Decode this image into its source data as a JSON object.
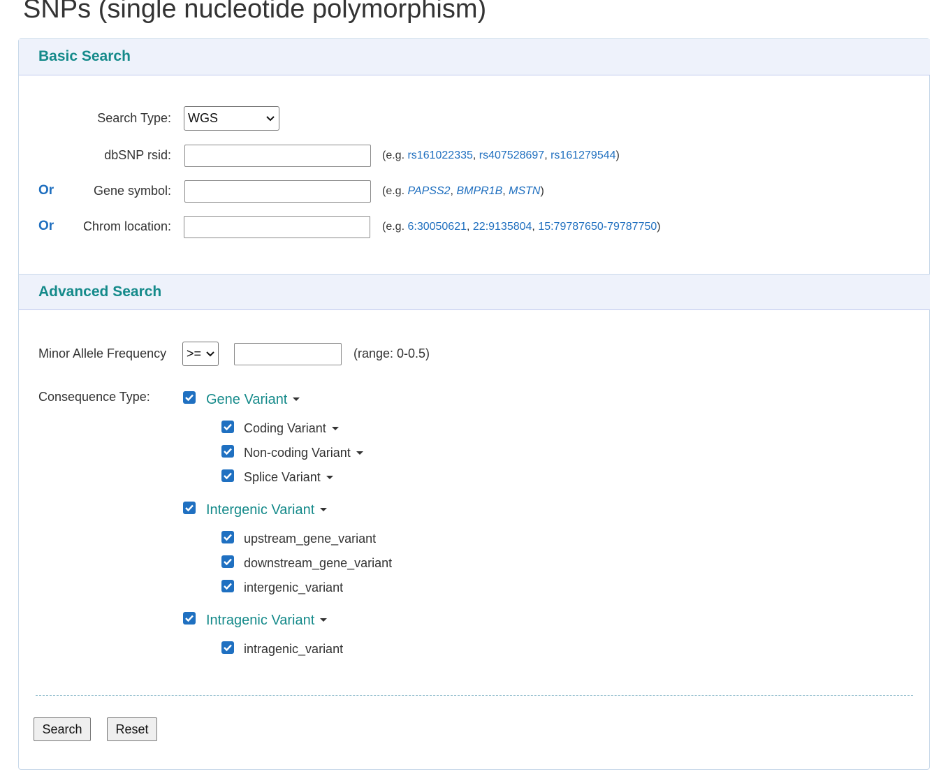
{
  "page": {
    "title": "SNPs (single nucleotide polymorphism)"
  },
  "basic": {
    "heading": "Basic Search",
    "search_type_label": "Search Type:",
    "search_type_value": "WGS",
    "rsid_label": "dbSNP rsid:",
    "rsid_value": "",
    "rsid_hint_prefix": "(e.g. ",
    "rsid_examples": [
      "rs161022335",
      "rs407528697",
      "rs161279544"
    ],
    "gene_or": "Or",
    "gene_label": "Gene symbol:",
    "gene_value": "",
    "gene_hint_prefix": "(e.g. ",
    "gene_examples": [
      "PAPSS2",
      "BMPR1B",
      "MSTN"
    ],
    "chrom_or": "Or",
    "chrom_label": "Chrom location:",
    "chrom_value": "",
    "chrom_hint_prefix": "(e.g. ",
    "chrom_examples": [
      "6:30050621",
      "22:9135804",
      "15:79787650-79787750"
    ],
    "hint_sep": ", ",
    "hint_suffix": ")"
  },
  "advanced": {
    "heading": "Advanced Search",
    "maf_label": "Minor Allele Frequency",
    "maf_operator": ">=",
    "maf_value": "",
    "maf_range": "(range: 0-0.5)",
    "consequence_label": "Consequence Type:",
    "groups": [
      {
        "label": "Gene Variant",
        "checked": true,
        "items": [
          {
            "label": "Coding Variant",
            "checked": true,
            "expandable": true
          },
          {
            "label": "Non-coding Variant",
            "checked": true,
            "expandable": true
          },
          {
            "label": "Splice Variant",
            "checked": true,
            "expandable": true
          }
        ]
      },
      {
        "label": "Intergenic Variant",
        "checked": true,
        "items": [
          {
            "label": "upstream_gene_variant",
            "checked": true,
            "expandable": false
          },
          {
            "label": "downstream_gene_variant",
            "checked": true,
            "expandable": false
          },
          {
            "label": "intergenic_variant",
            "checked": true,
            "expandable": false
          }
        ]
      },
      {
        "label": "Intragenic Variant",
        "checked": true,
        "items": [
          {
            "label": "intragenic_variant",
            "checked": true,
            "expandable": false
          }
        ]
      }
    ]
  },
  "actions": {
    "search_label": "Search",
    "reset_label": "Reset"
  },
  "colors": {
    "accent_teal": "#158a8a",
    "link_blue": "#1f6fbf",
    "checkbox_blue": "#1f70c1",
    "header_bg": "#eef2fb"
  }
}
